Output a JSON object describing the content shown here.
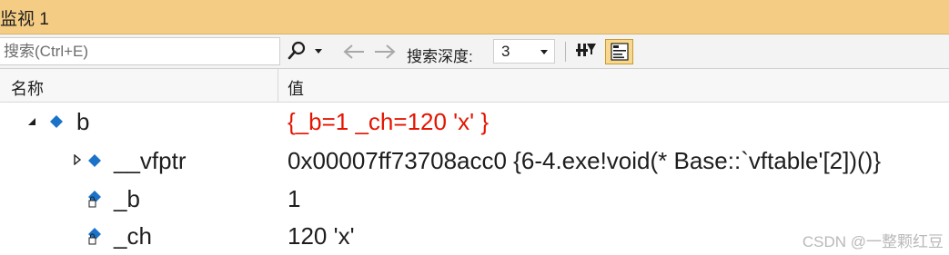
{
  "window": {
    "title": "监视 1"
  },
  "toolbar": {
    "search_placeholder": "搜索(Ctrl+E)",
    "search_value": "",
    "depth_label": "搜索深度:",
    "depth_value": "3",
    "icons": [
      "search-icon",
      "dropdown-arrow-icon",
      "back-arrow-icon",
      "forward-arrow-icon",
      "chevron-down-icon",
      "pin-filter-icon",
      "text-view-icon"
    ]
  },
  "columns": {
    "name": "名称",
    "value": "值"
  },
  "rows": [
    {
      "name": "b",
      "value": "{_b=1 _ch=120 'x' }",
      "expanded": true,
      "value_changed": true,
      "icon": "field-icon"
    },
    {
      "name": "__vfptr",
      "value": "0x00007ff73708acc0 {6-4.exe!void(* Base::`vftable'[2])()}",
      "expanded": false,
      "value_changed": false,
      "icon": "field-icon"
    },
    {
      "name": "_b",
      "value": "1",
      "value_changed": false,
      "icon": "private-field-icon"
    },
    {
      "name": "_ch",
      "value": "120 'x'",
      "value_changed": false,
      "icon": "private-field-icon"
    }
  ],
  "watermark": "CSDN @一整颗红豆",
  "colors": {
    "title_bar": "#f5cc84",
    "changed_value": "#e51400",
    "icon_blue": "#1a73c8"
  }
}
